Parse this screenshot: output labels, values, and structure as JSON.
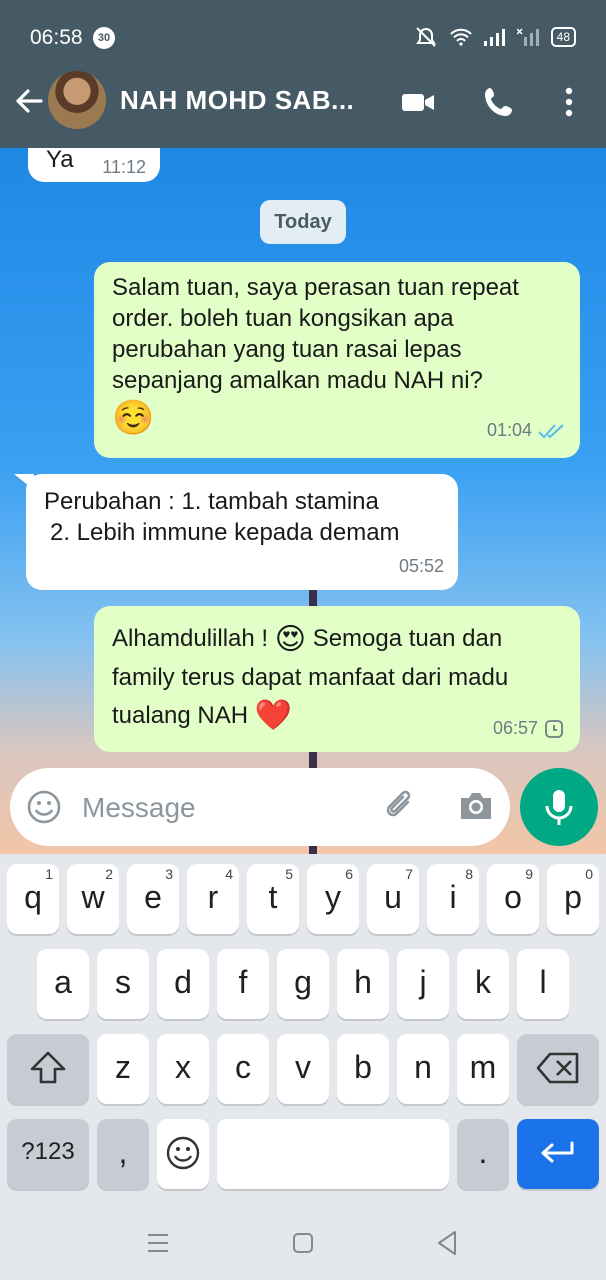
{
  "status": {
    "time": "06:58",
    "notification_count": "30",
    "battery": "48"
  },
  "header": {
    "contact_name": "NAH MOHD SAB..."
  },
  "chat": {
    "prev_message": {
      "text": "Ya",
      "time": "11:12"
    },
    "day_divider": "Today",
    "messages": [
      {
        "direction": "outgoing",
        "text": "Salam tuan, saya perasan tuan repeat order. boleh tuan kongsikan apa perubahan yang tuan rasai lepas sepanjang amalkan madu NAH ni?",
        "emoji": "☺️",
        "time": "01:04",
        "status": "read"
      },
      {
        "direction": "incoming",
        "line1": "Perubahan : 1. tambah stamina",
        "line2": "2. Lebih immune kepada demam",
        "time": "05:52"
      },
      {
        "direction": "outgoing",
        "part1": "Alhamdulillah ! ",
        "emoji1": "😍",
        "part2": " Semoga tuan dan family terus dapat manfaat dari madu tualang NAH ",
        "emoji2": "❤️",
        "time": "06:57",
        "status": "pending"
      }
    ]
  },
  "composer": {
    "placeholder": "Message"
  },
  "keyboard": {
    "row1": [
      [
        "q",
        "1"
      ],
      [
        "w",
        "2"
      ],
      [
        "e",
        "3"
      ],
      [
        "r",
        "4"
      ],
      [
        "t",
        "5"
      ],
      [
        "y",
        "6"
      ],
      [
        "u",
        "7"
      ],
      [
        "i",
        "8"
      ],
      [
        "o",
        "9"
      ],
      [
        "p",
        "0"
      ]
    ],
    "row2": [
      "a",
      "s",
      "d",
      "f",
      "g",
      "h",
      "j",
      "k",
      "l"
    ],
    "row3": [
      "z",
      "x",
      "c",
      "v",
      "b",
      "n",
      "m"
    ],
    "symbols_label": "?123",
    "comma": ",",
    "period": "."
  },
  "colors": {
    "header": "#455a64",
    "outgoing_bubble": "#e1ffc7",
    "mic": "#00a884",
    "enter_key": "#1a73e8"
  }
}
